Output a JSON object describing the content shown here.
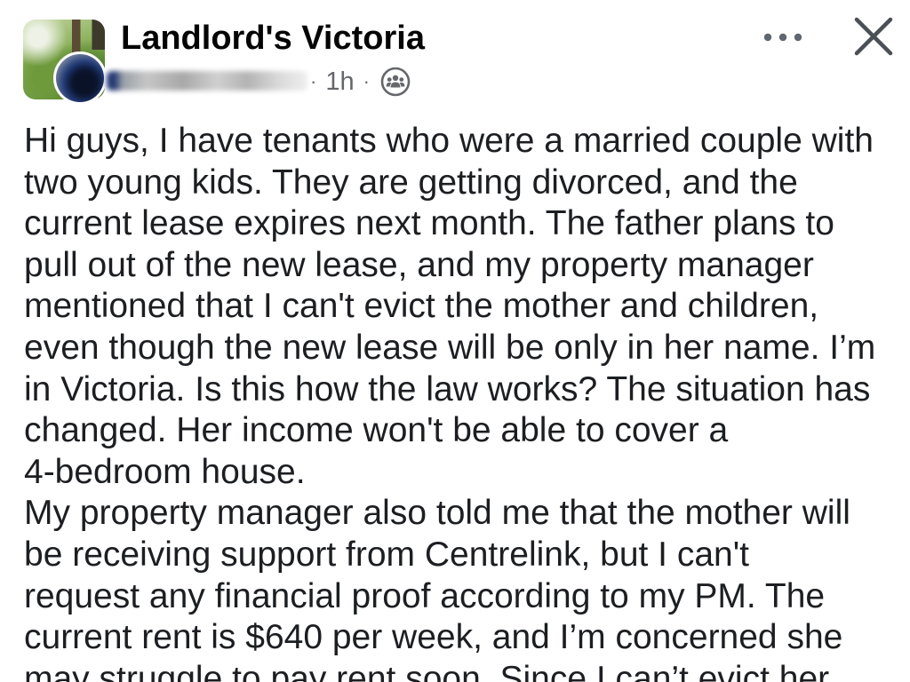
{
  "post": {
    "group_name": "Landlord's Victoria",
    "separator": "·",
    "timestamp": "1h",
    "body_lines": [
      "Hi guys, I have tenants who were a married couple with",
      "two young kids. They are getting divorced, and the",
      "current lease expires next month. The father plans to",
      "pull out of the new lease, and my property manager",
      "mentioned that I can't evict the mother and children,",
      "even though the new lease will be only in her name. I’m",
      "in Victoria. Is this how the law works? The situation has",
      "changed. Her income won't be able to cover a",
      "4-bedroom house.",
      "My property manager also told me that the mother will",
      "be receiving support from Centrelink, but I can't",
      "request any financial proof according to my PM. The",
      "current rent is $640 per week, and I’m concerned she",
      "may struggle to pay rent soon. Since I can’t evict her"
    ]
  },
  "icons": {
    "audience": "members-group-icon",
    "more": "more-horizontal-icon",
    "close": "close-icon"
  },
  "colors": {
    "background": "#ffffff",
    "title": "#050505",
    "text": "#1c1e21",
    "secondary": "#65676b"
  }
}
